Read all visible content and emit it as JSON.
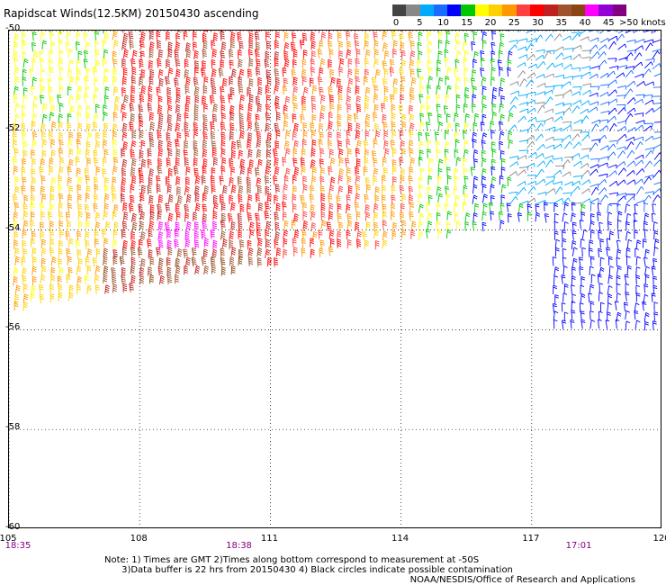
{
  "title": "Rapidscat Winds(12.5KM) 20150430 ascending",
  "legend": {
    "colors": [
      "#444444",
      "#888888",
      "#00aaff",
      "#1e6bff",
      "#0000ff",
      "#00c800",
      "#ffff00",
      "#ffd000",
      "#ff9900",
      "#ff4040",
      "#ff0000",
      "#c02020",
      "#a0522d",
      "#8b4513",
      "#ff00ff",
      "#9400d3",
      "#800080"
    ],
    "labels": [
      "0",
      "5",
      "10",
      "15",
      "20",
      "25",
      "30",
      "35",
      "40",
      "45"
    ],
    "max_label": ">50 knots"
  },
  "axes": {
    "x_ticks": [
      "105",
      "108",
      "111",
      "114",
      "117",
      "120"
    ],
    "y_ticks": [
      "-50",
      "-52",
      "-54",
      "-56",
      "-58",
      "-60"
    ],
    "xlim": [
      105,
      120
    ],
    "ylim": [
      -60,
      -50
    ]
  },
  "times": [
    {
      "lon": 105,
      "label": "18:35"
    },
    {
      "lon": 110.3,
      "label": "18:38"
    },
    {
      "lon": 118.1,
      "label": "17:01"
    }
  ],
  "notes": {
    "line1": "Note: 1) Times are GMT 2)Times along bottom correspond to measurement at -50S",
    "line2": "3)Data buffer is 22 hrs from 20150430 4) Black circles indicate possible contamination"
  },
  "credit": "NOAA/NESDIS/Office of Research and Applications",
  "icons": {
    "wind_barb": "wind-barb-icon"
  }
}
